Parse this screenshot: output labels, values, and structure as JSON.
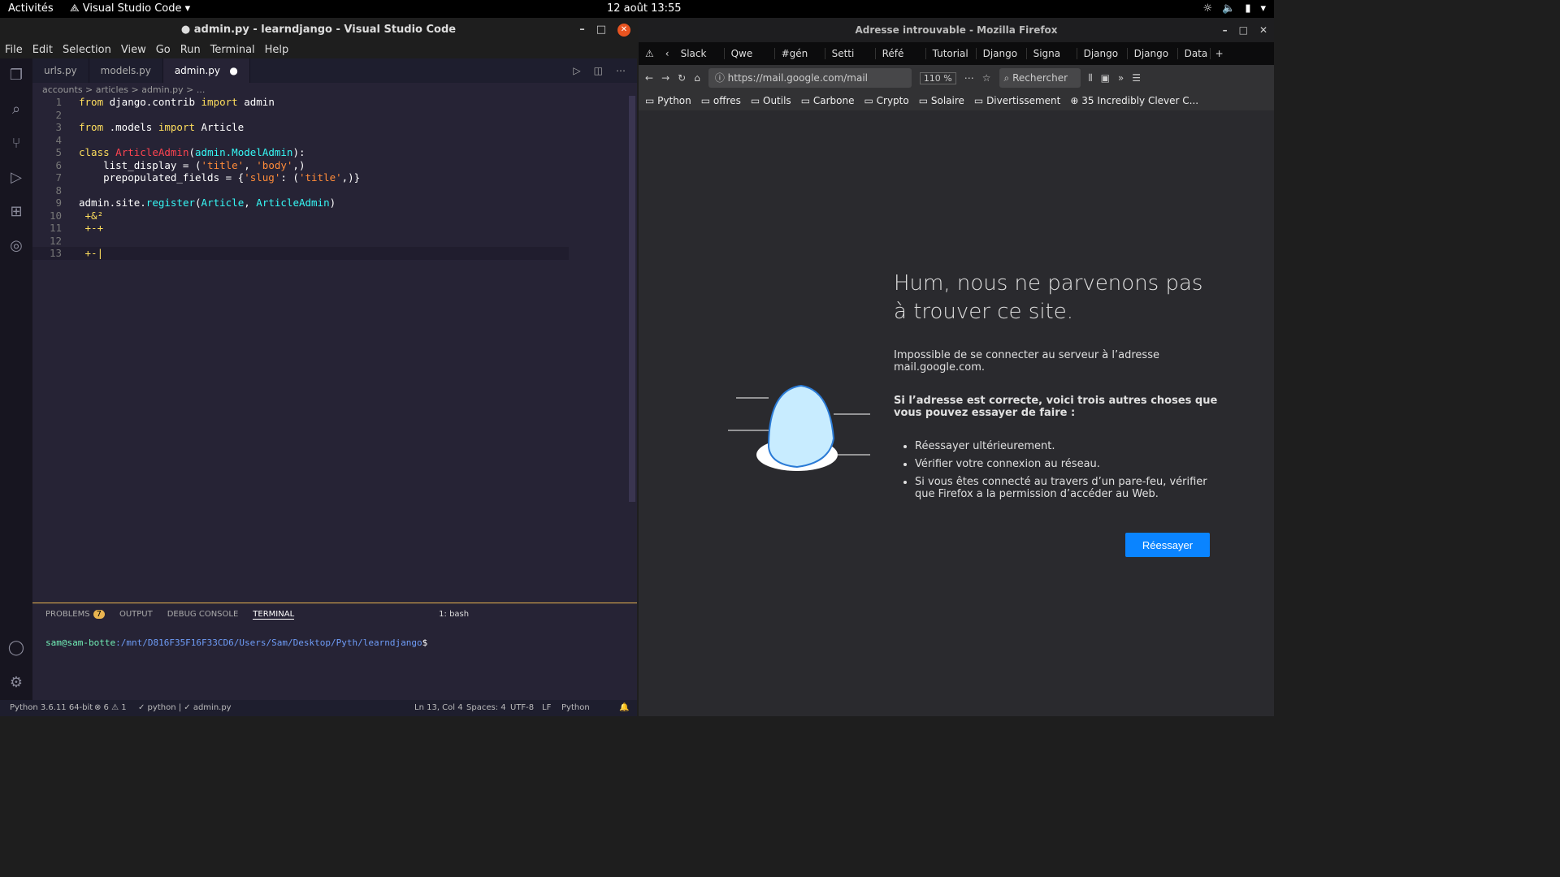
{
  "system": {
    "activities": "Activités",
    "app_menu": "Visual Studio Code",
    "clock": "12 août  13:55"
  },
  "vscode": {
    "title": "● admin.py - learndjango - Visual Studio Code",
    "menu": [
      "File",
      "Edit",
      "Selection",
      "View",
      "Go",
      "Run",
      "Terminal",
      "Help"
    ],
    "tabs": [
      "urls.py",
      "models.py",
      "admin.py"
    ],
    "breadcrumb": "accounts > articles > admin.py > ...",
    "lines": [
      "from django.contrib import admin",
      "",
      "from .models import Article",
      "",
      "class ArticleAdmin(admin.ModelAdmin):",
      "    list_display = ('title', 'body',)",
      "    prepopulated_fields = {'slug': ('title',)}",
      "",
      "admin.site.register(Article, ArticleAdmin)",
      " +&²",
      " +-+",
      "",
      " +-"
    ],
    "panel": {
      "problems": "PROBLEMS",
      "problems_count": "7",
      "output": "OUTPUT",
      "debug": "DEBUG CONSOLE",
      "terminal": "TERMINAL",
      "shell": "1: bash"
    },
    "terminal_user": "sam@sam-botte",
    "terminal_path": ":/mnt/D816F35F16F33CD6/Users/Sam/Desktop/Pyth/learndjango",
    "terminal_prompt": "$",
    "status": {
      "python": "Python 3.6.11 64-bit",
      "errors": "⊗ 6 ⚠ 1",
      "lint": "✓ python | ✓ admin.py",
      "pos": "Ln 13, Col 4",
      "spaces": "Spaces: 4",
      "enc": "UTF-8",
      "eol": "LF",
      "lang": "Python"
    }
  },
  "firefox": {
    "title": "Adresse introuvable - Mozilla Firefox",
    "tabs": [
      "Slack",
      "Qwe",
      "#gén",
      "Setti",
      "Réfé",
      "Tutorial",
      "Django",
      "Signa",
      "Django",
      "Django",
      "Data"
    ],
    "url": "https://mail.google.com/mail",
    "zoom": "110 %",
    "search_placeholder": "Rechercher",
    "bookmarks": [
      "Python",
      "offres",
      "Outils",
      "Carbone",
      "Crypto",
      "Solaire",
      "Divertissement",
      "35 Incredibly Clever C..."
    ],
    "error_title": "Hum, nous ne parvenons pas à trouver ce site.",
    "error_desc": "Impossible de se connecter au serveur à l’adresse mail.google.com.",
    "error_hint": "Si l’adresse est correcte, voici trois autres choses que vous pouvez essayer de faire :",
    "suggestions": [
      "Réessayer ultérieurement.",
      "Vérifier votre connexion au réseau.",
      "Si vous êtes connecté au travers d’un pare-feu, vérifier que Firefox a la permission d’accéder au Web."
    ],
    "retry": "Réessayer"
  }
}
